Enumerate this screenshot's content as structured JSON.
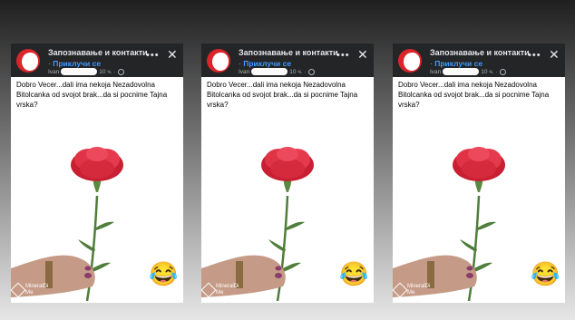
{
  "cards": [
    {
      "group_name": "Запознавање и контакти",
      "join_label": "Приклучи се",
      "author": "Ivan",
      "time": "10 ч.",
      "post_text": "Dobro  Vecer...dali ima nekoja Nezadovolna Bitolcanka od svojot brak...da si pocnime Tajna vrska?",
      "emoji": "😂",
      "watermark_line1": "Mineral­Di",
      "watermark_line2": "Ме"
    },
    {
      "group_name": "Запознавање и контакти",
      "join_label": "Приклучи се",
      "author": "Ivan",
      "time": "10 ч.",
      "post_text": "Dobro  Vecer...dali ima nekoja Nezadovolna Bitolcanka od svojot brak...da si pocnime Tajna vrska?",
      "emoji": "😂",
      "watermark_line1": "Mineral­Di",
      "watermark_line2": "Ме"
    },
    {
      "group_name": "Запознавање и контакти",
      "join_label": "Приклучи се",
      "author": "Ivan",
      "time": "10 ч.",
      "post_text": "Dobro  Vecer...dali ima nekoja Nezadovolna Bitolcanka od svojot brak...da si pocnime Tajna vrska?",
      "emoji": "😂",
      "watermark_line1": "Mineral­Di",
      "watermark_line2": "Ме"
    }
  ],
  "icons": {
    "more": "more-dots-icon",
    "close": "close-icon",
    "globe": "globe-icon"
  },
  "colors": {
    "header_bg": "#242526",
    "join_link": "#3e9bff",
    "avatar": "#d9252b",
    "flower": "#d92b3a",
    "stem": "#4f7d3a"
  }
}
